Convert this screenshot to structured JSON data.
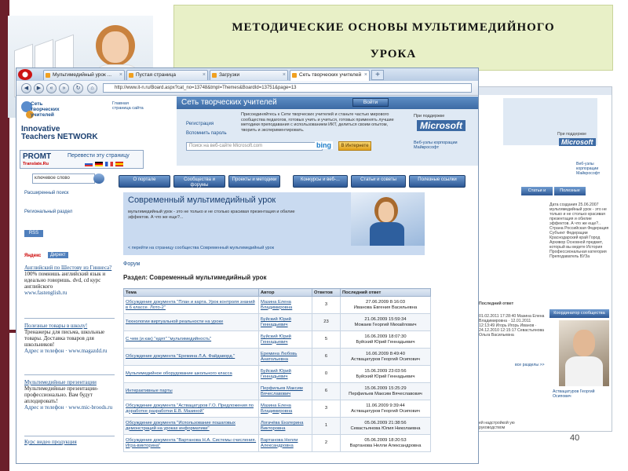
{
  "slide": {
    "title_line1": "МЕТОДИЧЕСКИЕ ОСНОВЫ МУЛЬТИМЕДИЙНОГО",
    "title_line2": "УРОКА",
    "number": "40"
  },
  "browser": {
    "tabs": [
      {
        "label": "Мультимедийный урок ..."
      },
      {
        "label": "Пустая страница"
      },
      {
        "label": "Загрузки"
      },
      {
        "label": "Сеть творческих учителей"
      }
    ],
    "address": "http://www.it-n.ru/Board.aspx?cat_no=13748&tmpl=Themes&BoardId=13751&page=13"
  },
  "site": {
    "logo_text": "Сеть творческих учителей",
    "innovative": "Innovative",
    "teachers_network": "Teachers NETWORK",
    "home_link": "Главная страница сайта",
    "promt_logo": "PROMT",
    "promt_site": "Translate.Ru",
    "promt_translate": "Перевести эту страницу",
    "banner_title": "Сеть творческих учителей",
    "login_label": "Войти",
    "banner_text": "Присоединяйтесь к Сети творческих учителей и станьте частью мирового сообщества педагогов, готовых учить и учиться, готовых применять лучшие методики преподавания с использованием ИКТ, делиться своим опытом, творить и экспериментировать.",
    "register_link": "Регистрация",
    "remember_link": "Вспомнить пароль",
    "ms_support": "При поддержке",
    "ms_logo": "Microsoft",
    "ms_web": "Веб-узлы корпорации Майкрософт",
    "site_search_placeholder": "Поиск на веб-сайте Microsoft.com",
    "bing": "bing",
    "internet_btn": "В Интернете",
    "menu": [
      "О портале",
      "Сообщества и форумы",
      "Проекты и методики",
      "Конкурсы и веб-...",
      "Статьи и советы",
      "Полезные ссылки"
    ],
    "left_search_value": "ключевое слово",
    "advanced_search": "Расширенный поиск",
    "regional_section": "Региональный раздел",
    "rss": "RSS",
    "yandex": "Яндекс",
    "direct": "Директ",
    "ads": [
      {
        "title": "Английский по Шестову из Гиннеса?",
        "text": "100% помнишь английский язык и идеально говоришь. dvd, cd курс английского",
        "link": "www.fastenglish.ru"
      },
      {
        "title": "Полезные товары в школу!",
        "text": "Тренажеры для письма, школьные товары. Доставка товаров для школьников!",
        "link": "Адрес и телефон · www.magazdd.ru"
      },
      {
        "title": "Мультимедийные презентации",
        "text": "Мультимедийные презентации-профессионально. Вам будут аплодировать!",
        "link": "Адрес и телефон · www.mic-broods.ru"
      },
      {
        "title": "Курс видео продукция",
        "text": "",
        "link": ""
      }
    ],
    "hero_title": "Современный мультимедийный урок",
    "hero_text": "мультимедийный урок - это не только и не столько красивая презентация и обилие эффектов. А что же еще?...",
    "hero_link": "< перейти на страницу сообщества Современный мультимедийный урок",
    "forum_link": "Форум",
    "section_title": "Раздел: Современный мультимедийный урок",
    "table": {
      "headers": [
        "Тема",
        "Автор",
        "Ответов",
        "Последний ответ"
      ],
      "rows": [
        {
          "topic": "Обсуждение документа \"План и карта. Урок контроля знаний в 6 классе. Лото-2\"",
          "author": "Мазина Елена Владимировна",
          "replies": "3",
          "date": "27.06.2009 8:16:03",
          "last_by": "Иванова Евгения Васильевна"
        },
        {
          "topic": "Технологии виртуальной реальности на уроке",
          "author": "Буйский Юрий Геннадьевич",
          "replies": "23",
          "date": "21.06.2009 15:59:34",
          "last_by": "Можаев Георгий Михайлович"
        },
        {
          "topic": "С чем (и как) \"едят\" \"мультимедийность\"",
          "author": "Буйский Юрий Геннадьевич",
          "replies": "5",
          "date": "16.06.2009 18:07:30",
          "last_by": "Буйский Юрий Геннадьевич"
        },
        {
          "topic": "Обсуждение документа \"Еремина Л.А. Файдаворд.\"",
          "author": "Еремина Любовь Анатольевна",
          "replies": "6",
          "date": "16.06.2009 8:49:40",
          "last_by": "Аствацатуров Георгий Осипович"
        },
        {
          "topic": "Мультимедийное оборудование школьного класса",
          "author": "Буйский Юрий Геннадьевич",
          "replies": "0",
          "date": "15.06.2009 23:03:56",
          "last_by": "Буйский Юрий Геннадьевич"
        },
        {
          "topic": "Интерактивные парты",
          "author": "Перфильев Максим Вячеславович",
          "replies": "6",
          "date": "15.06.2009 15:25:29",
          "last_by": "Перфильев Максим Вячеславович"
        },
        {
          "topic": "Обсуждение документа \"Аствацатуров Г.О. Предложения по доработке разработки Е.В. Мазиной\"",
          "author": "Мазина Елена Владимировна",
          "replies": "3",
          "date": "11.06.2009 9:39:44",
          "last_by": "Аствацатуров Георгий Осипович"
        },
        {
          "topic": "Обсуждение документа \"Использование пошаговых демонстраций на уроках информатики\"",
          "author": "Логачёва Екатерина Викторовна",
          "replies": "1",
          "date": "05.06.2009 21:38:56",
          "last_by": "Севастьянова Юлия Николаевна"
        },
        {
          "topic": "Обсуждение документа \"Вартанова Н.А. Системы счисления. Игра-викторина\"",
          "author": "Вартанова Нелли Александровна",
          "replies": "2",
          "date": "05.06.2009 18:20:53",
          "last_by": "Вартанова Нелли Александровна"
        }
      ]
    }
  },
  "bg": {
    "ms_support": "При поддержке",
    "ms_logo": "Microsoft",
    "ms_web": "Веб-узлы корпорации Майкрософт",
    "btn1": "Статьи и советы",
    "btn2": "Полезные ссылки",
    "info": "Дата создания 25.06.2007 мультимедийный урок - это не только и не столько красивая презентация и обилие эффектов. А что же еще?.. Страна Российская Федерация Субъект Федерации Краснодарский край Город Архивор Основной предмет, который вы ведете История Профессиональная категория Преподаватель ВУЗа",
    "col_title": "Последний ответ",
    "moderator": "Координатор сообщества",
    "moderator_name": "Аствацатуров Георгий Осипович",
    "entries": "01.02.2011 17:28:40 Мазина Елена Владимировна · 12.01.2011 12:13:49 Игорь Игорь Иванов · 24.12.2010 12:15:17 Севастьянова Ольга Васильевна",
    "more": "все разделы >>",
    "bottom": "ей надстройкой ую руководством"
  }
}
